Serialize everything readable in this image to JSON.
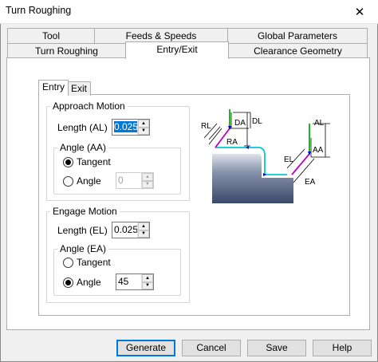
{
  "window": {
    "title": "Turn Roughing",
    "close_glyph": "✕"
  },
  "tabs": {
    "row_back": [
      "Tool",
      "Feeds & Speeds",
      "Global Parameters"
    ],
    "row_front": [
      "Turn Roughing",
      "Entry/Exit",
      "Clearance Geometry"
    ],
    "active": "Entry/Exit"
  },
  "subtabs": {
    "items": [
      "Entry",
      "Exit"
    ],
    "active": "Entry"
  },
  "approach": {
    "group_label": "Approach Motion",
    "length_label": "Length (AL)",
    "length_value": "0.025",
    "angle_group_label": "Angle (AA)",
    "tangent_label": "Tangent",
    "angle_label": "Angle",
    "angle_value": "0",
    "selected": "Tangent"
  },
  "engage": {
    "group_label": "Engage Motion",
    "length_label": "Length (EL)",
    "length_value": "0.025",
    "angle_group_label": "Angle (EA)",
    "tangent_label": "Tangent",
    "angle_label": "Angle",
    "angle_value": "45",
    "selected": "Angle"
  },
  "diagram": {
    "labels": {
      "rl": "RL",
      "da": "DA",
      "dl": "DL",
      "ra": "RA",
      "al": "AL",
      "aa": "AA",
      "el": "EL",
      "ea": "EA"
    },
    "colors": {
      "part": "#4a5a7a",
      "path": "#00c8d8",
      "approach": "#00b000",
      "engage": "#c000c0",
      "marker": "#0000c0"
    }
  },
  "buttons": {
    "generate": "Generate",
    "cancel": "Cancel",
    "save": "Save",
    "help": "Help"
  },
  "icons": {
    "spin_up": "▲",
    "spin_down": "▼"
  }
}
